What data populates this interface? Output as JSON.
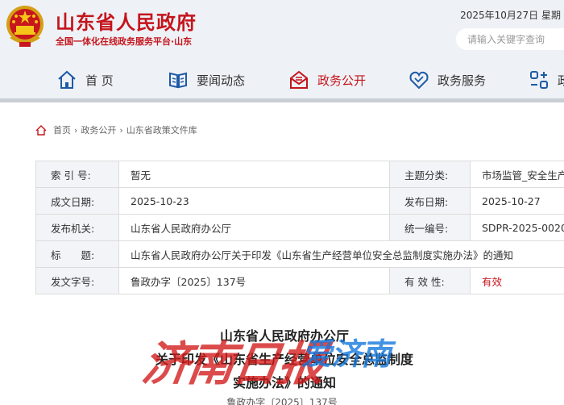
{
  "header": {
    "site_title": "山东省人民政府",
    "site_subtitle": "全国一体化在线政务服务平台·山东",
    "date": "2025年10月27日  星期",
    "search_placeholder": "请输入关键字查询",
    "emblem_icon": "national-emblem-icon",
    "accent_color": "#c4151c"
  },
  "nav": {
    "home": "首 页",
    "news": "要闻动态",
    "affairs": "政务公开",
    "service": "政务服务",
    "interact": "政"
  },
  "breadcrumb": {
    "home": "首页",
    "level1": "政务公开",
    "level2": "山东省政策文件库",
    "sep": "›"
  },
  "info": {
    "index_label": "索 引 号:",
    "index_value": "暂无",
    "category_label": "主题分类:",
    "category_value": "市场监管_安全生产",
    "created_label": "成文日期:",
    "created_value": "2025-10-23",
    "published_label": "发布日期:",
    "published_value": "2025-10-27",
    "issuer_label": "发布机关:",
    "issuer_value": "山东省人民政府办公厅",
    "serial_label": "统一编号:",
    "serial_value": "SDPR-2025-0020",
    "title_label": "标　　题:",
    "title_value": "山东省人民政府办公厅关于印发《山东省生产经营单位安全总监制度实施办法》的通知",
    "docno_label": "发文字号:",
    "docno_value": "鲁政办字〔2025〕137号",
    "validity_label": "有 效 性:",
    "validity_value": "有效"
  },
  "document": {
    "title_line1": "山东省人民政府办公厅",
    "title_line2": "关于印发《山东省生产经营单位安全总监制度",
    "title_line3": "实施办法》的通知",
    "doc_number": "鲁政办字〔2025〕137号"
  },
  "watermark": {
    "red_text": "济南日报",
    "blue_text": "爱济南"
  }
}
